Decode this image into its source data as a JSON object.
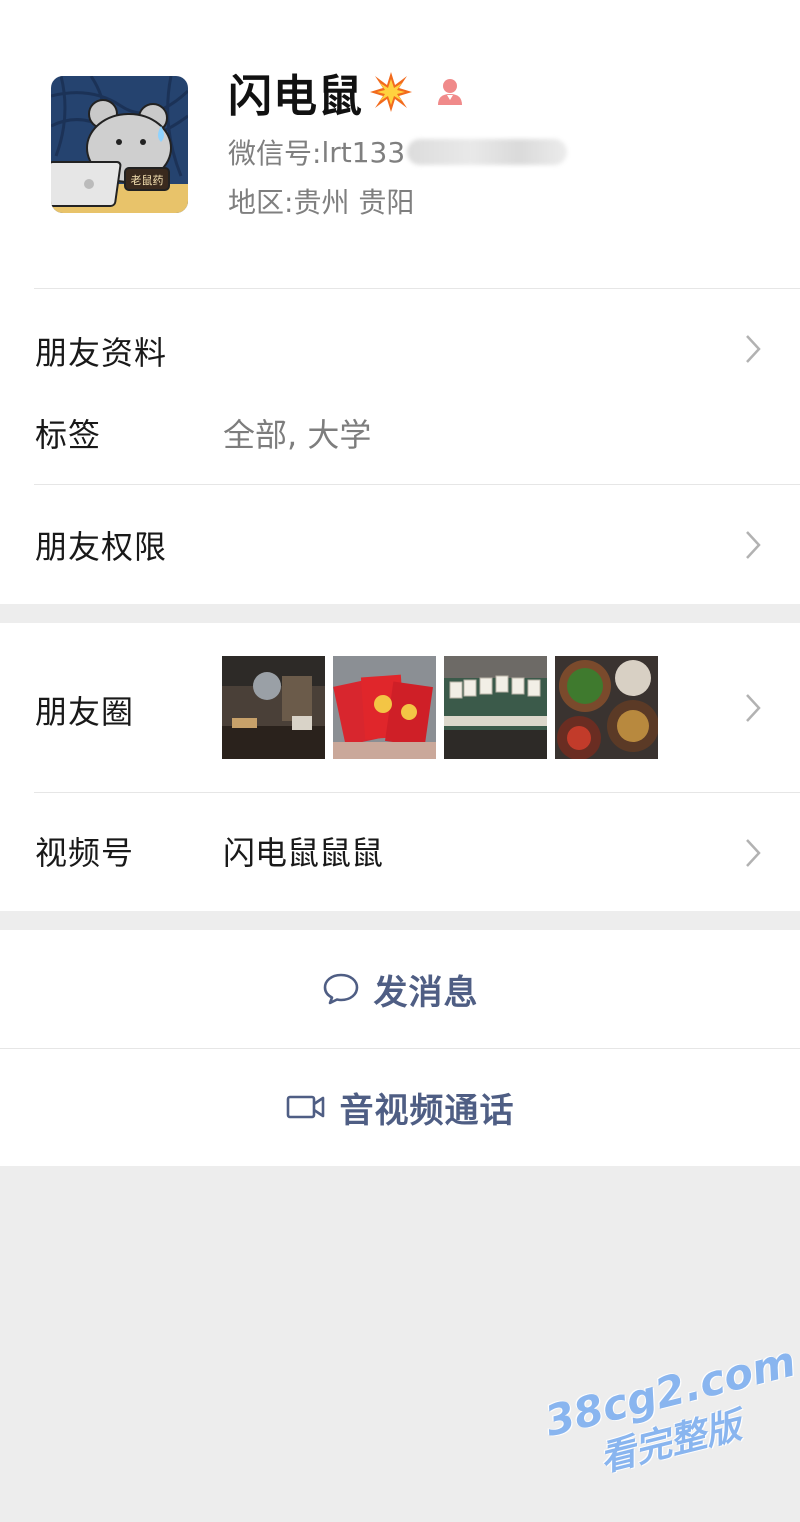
{
  "profile": {
    "nickname": "闪电鼠",
    "wechat_id_label": "微信号:",
    "wechat_id_visible": "lrt133",
    "region_label": "地区:",
    "region_value": "贵州 贵阳",
    "avatar_badge_text": "老鼠药",
    "nickname_emoji_icon": "collision-spark-icon",
    "gender_icon": "person-female-icon"
  },
  "rows": {
    "friend_profile": {
      "label": "朋友资料"
    },
    "tags": {
      "label": "标签",
      "value": "全部, 大学"
    },
    "permissions": {
      "label": "朋友权限"
    },
    "moments": {
      "label": "朋友圈",
      "thumbnails": [
        "moment-photo-restaurant",
        "moment-photo-red-envelopes",
        "moment-photo-mahjong",
        "moment-photo-food"
      ]
    },
    "channels": {
      "label": "视频号",
      "value": "闪电鼠鼠鼠"
    }
  },
  "actions": {
    "send_message": {
      "label": "发消息",
      "icon": "chat-bubble-icon"
    },
    "av_call": {
      "label": "音视频通话",
      "icon": "video-camera-icon"
    }
  },
  "watermark": {
    "line1": "38cg2.com",
    "line2": "看完整版"
  },
  "colors": {
    "action_text": "#4f5e84",
    "secondary_text": "#7f7f7f",
    "background": "#ededed",
    "watermark": "#7fb0f0"
  }
}
